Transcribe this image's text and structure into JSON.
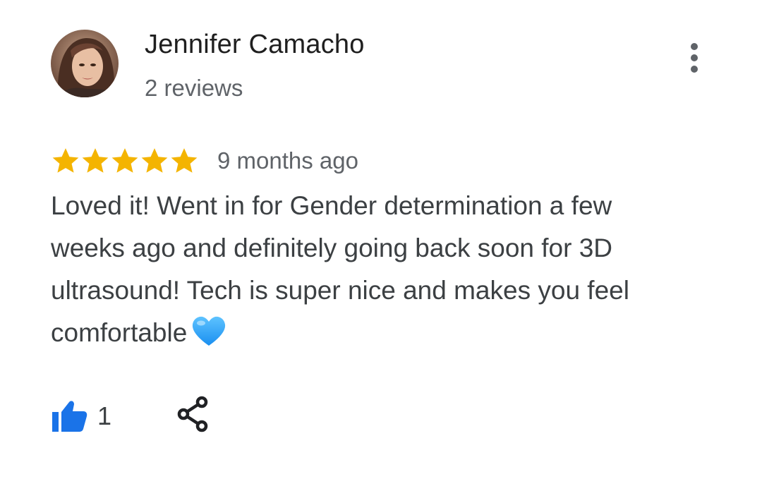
{
  "review": {
    "author": {
      "name": "Jennifer Camacho",
      "review_count": "2 reviews",
      "avatar_icon": "user-avatar-photo"
    },
    "rating": {
      "stars": 5,
      "max_stars": 5,
      "star_color": "#f4b400"
    },
    "time": "9 months ago",
    "text": "Loved it! Went in for Gender determination a few weeks ago and definitely going back soon for 3D ultrasound! Tech is super nice and makes you feel comfortable",
    "emoji": "blue-heart-emoji",
    "actions": {
      "like_icon": "thumbs-up-icon",
      "like_count": "1",
      "like_color": "#1a73e8",
      "share_icon": "share-icon",
      "more_icon": "more-vert-icon"
    }
  }
}
